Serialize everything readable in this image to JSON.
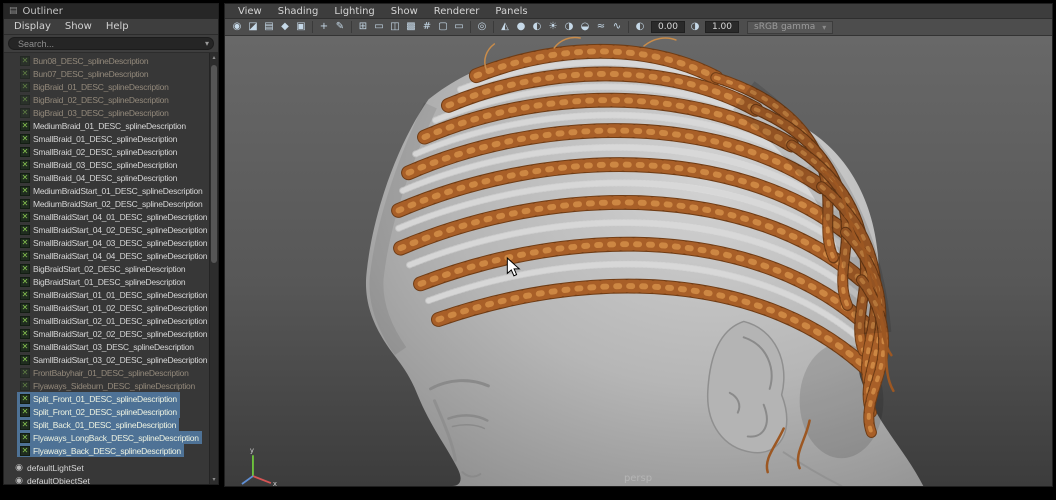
{
  "outliner": {
    "title": "Outliner",
    "menus": [
      "Display",
      "Show",
      "Help"
    ],
    "search": {
      "placeholder": "Search..."
    },
    "items": [
      {
        "label": "Bun08_DESC_splineDescription",
        "state": "dim"
      },
      {
        "label": "Bun07_DESC_splineDescription",
        "state": "dim"
      },
      {
        "label": "BigBraid_01_DESC_splineDescription",
        "state": "dim"
      },
      {
        "label": "BigBraid_02_DESC_splineDescription",
        "state": "dim"
      },
      {
        "label": "BigBraid_03_DESC_splineDescription",
        "state": "dim"
      },
      {
        "label": "MediumBraid_01_DESC_splineDescription",
        "state": "normal"
      },
      {
        "label": "SmallBraid_01_DESC_splineDescription",
        "state": "normal"
      },
      {
        "label": "SmallBraid_02_DESC_splineDescription",
        "state": "normal"
      },
      {
        "label": "SmallBraid_03_DESC_splineDescription",
        "state": "normal"
      },
      {
        "label": "SmallBraid_04_DESC_splineDescription",
        "state": "normal"
      },
      {
        "label": "MediumBraidStart_01_DESC_splineDescription",
        "state": "normal"
      },
      {
        "label": "MediumBraidStart_02_DESC_splineDescription",
        "state": "normal"
      },
      {
        "label": "SmallBraidStart_04_01_DESC_splineDescription",
        "state": "normal"
      },
      {
        "label": "SmallBraidStart_04_02_DESC_splineDescription",
        "state": "normal"
      },
      {
        "label": "SmallBraidStart_04_03_DESC_splineDescription",
        "state": "normal"
      },
      {
        "label": "SmallBraidStart_04_04_DESC_splineDescription",
        "state": "normal"
      },
      {
        "label": "BigBraidStart_02_DESC_splineDescription",
        "state": "normal"
      },
      {
        "label": "BigBraidStart_01_DESC_splineDescription",
        "state": "normal"
      },
      {
        "label": "SmallBraidStart_01_01_DESC_splineDescription",
        "state": "normal"
      },
      {
        "label": "SmallBraidStart_01_02_DESC_splineDescription",
        "state": "normal"
      },
      {
        "label": "SmallBraidStart_02_01_DESC_splineDescription",
        "state": "normal"
      },
      {
        "label": "SmallBraidStart_02_02_DESC_splineDescription",
        "state": "normal"
      },
      {
        "label": "SmallBraidStart_03_DESC_splineDescription",
        "state": "normal"
      },
      {
        "label": "SamllBraidStart_03_02_DESC_splineDescription",
        "state": "normal"
      },
      {
        "label": "FrontBabyhair_01_DESC_splineDescription",
        "state": "dim"
      },
      {
        "label": "Flyaways_Sideburn_DESC_splineDescription",
        "state": "dim"
      },
      {
        "label": "Split_Front_01_DESC_splineDescription",
        "state": "selected"
      },
      {
        "label": "Split_Front_02_DESC_splineDescription",
        "state": "selected"
      },
      {
        "label": "Split_Back_01_DESC_splineDescription",
        "state": "selected"
      },
      {
        "label": "Flyaways_LongBack_DESC_splineDescription",
        "state": "selected"
      },
      {
        "label": "Flyaways_Back_DESC_splineDescription",
        "state": "selected"
      }
    ],
    "sets": [
      {
        "label": "defaultLightSet"
      },
      {
        "label": "defaultObjectSet"
      }
    ]
  },
  "viewport": {
    "menus": [
      "View",
      "Shading",
      "Lighting",
      "Show",
      "Renderer",
      "Panels"
    ],
    "toolbar": {
      "icons": [
        {
          "name": "select-camera-icon",
          "glyph": "◉"
        },
        {
          "name": "lock-camera-icon",
          "glyph": "◪"
        },
        {
          "name": "camera-attributes-icon",
          "glyph": "▤"
        },
        {
          "name": "bookmarks-icon",
          "glyph": "◆"
        },
        {
          "name": "image-plane-icon",
          "glyph": "▣"
        },
        {
          "name": "separator",
          "glyph": "",
          "type": "sep"
        },
        {
          "name": "pan-zoom-icon",
          "glyph": "+"
        },
        {
          "name": "grease-pencil-icon",
          "glyph": "✎"
        },
        {
          "name": "separator",
          "glyph": "",
          "type": "sep"
        },
        {
          "name": "grid-icon",
          "glyph": "⊞"
        },
        {
          "name": "film-gate-icon",
          "glyph": "▭"
        },
        {
          "name": "resolution-gate-icon",
          "glyph": "◫"
        },
        {
          "name": "gate-mask-icon",
          "glyph": "▩"
        },
        {
          "name": "field-chart-icon",
          "glyph": "#"
        },
        {
          "name": "safe-action-icon",
          "glyph": "▢"
        },
        {
          "name": "safe-title-icon",
          "glyph": "▭"
        },
        {
          "name": "separator",
          "glyph": "",
          "type": "sep"
        },
        {
          "name": "isolate-select-icon",
          "glyph": "◎"
        },
        {
          "name": "separator",
          "glyph": "",
          "type": "sep"
        },
        {
          "name": "wireframe-icon",
          "glyph": "◭"
        },
        {
          "name": "smooth-shade-icon",
          "glyph": "●"
        },
        {
          "name": "textured-icon",
          "glyph": "◐"
        },
        {
          "name": "use-all-lights-icon",
          "glyph": "☀"
        },
        {
          "name": "shadows-icon",
          "glyph": "◑"
        },
        {
          "name": "ambient-occlusion-icon",
          "glyph": "◒"
        },
        {
          "name": "motion-blur-icon",
          "glyph": "≈"
        },
        {
          "name": "anti-aliasing-icon",
          "glyph": "∿"
        },
        {
          "name": "separator",
          "glyph": "",
          "type": "sep"
        },
        {
          "name": "exposure-icon",
          "glyph": "◐"
        }
      ],
      "exposure_value": "0.00",
      "gamma_value": "1.00",
      "view_transform": "sRGB gamma"
    },
    "camera_label": "persp",
    "axis": {
      "x": "x",
      "y": "y",
      "z": "z"
    }
  },
  "colors": {
    "selection_highlight": "#4e7296",
    "braid_copper": "#a85f28",
    "head_gray": "#b6b6b6",
    "viewport_bg_top": "#686868",
    "viewport_bg_bottom": "#3c3c3c",
    "panel_bg": "#373737"
  }
}
